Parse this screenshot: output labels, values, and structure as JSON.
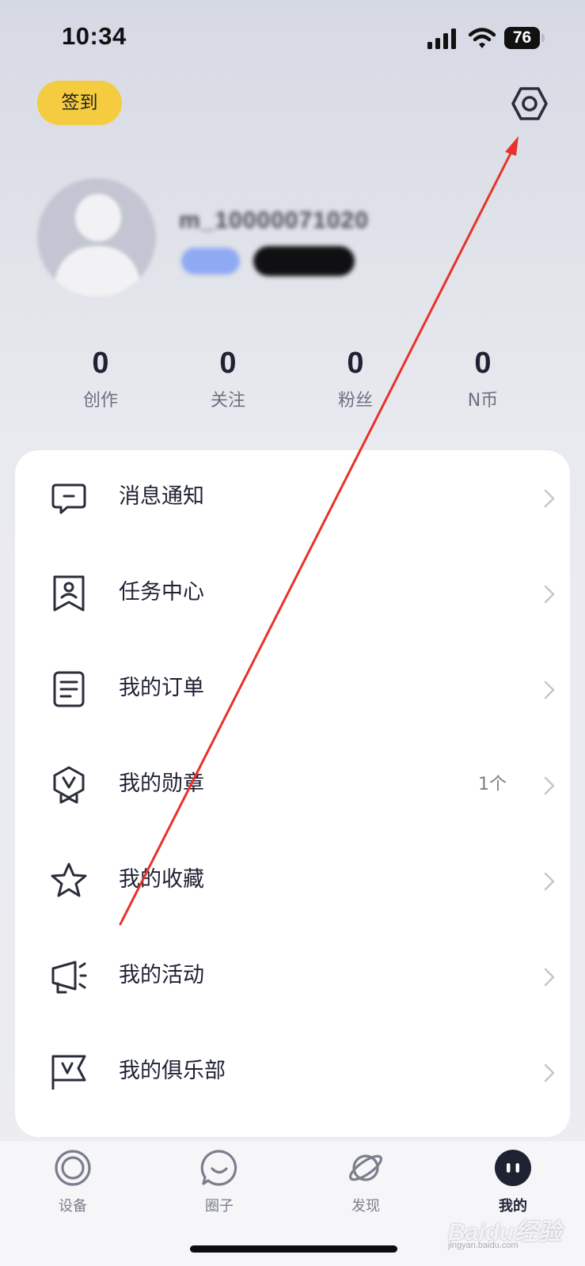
{
  "status_bar": {
    "time": "10:34",
    "battery": "76",
    "icons": [
      "signal-icon",
      "wifi-icon",
      "battery-icon"
    ]
  },
  "header": {
    "checkin_label": "签到",
    "settings_icon": "settings-hexagon-icon"
  },
  "profile": {
    "username": "m_10000071020"
  },
  "stats": [
    {
      "value": "0",
      "label": "创作"
    },
    {
      "value": "0",
      "label": "关注"
    },
    {
      "value": "0",
      "label": "粉丝"
    },
    {
      "value": "0",
      "label": "N币"
    }
  ],
  "menu": {
    "items": [
      {
        "label": "消息通知",
        "icon": "message-icon",
        "extra": ""
      },
      {
        "label": "任务中心",
        "icon": "task-badge-icon",
        "extra": ""
      },
      {
        "label": "我的订单",
        "icon": "order-document-icon",
        "extra": ""
      },
      {
        "label": "我的勋章",
        "icon": "medal-icon",
        "extra": "1个"
      },
      {
        "label": "我的收藏",
        "icon": "star-icon",
        "extra": ""
      },
      {
        "label": "我的活动",
        "icon": "megaphone-icon",
        "extra": ""
      },
      {
        "label": "我的俱乐部",
        "icon": "club-flag-icon",
        "extra": ""
      }
    ]
  },
  "tab_bar": {
    "tabs": [
      {
        "label": "设备",
        "icon": "device-ring-icon",
        "active": false
      },
      {
        "label": "圈子",
        "icon": "circle-chat-icon",
        "active": false
      },
      {
        "label": "发现",
        "icon": "planet-icon",
        "active": false
      },
      {
        "label": "我的",
        "icon": "profile-face-icon",
        "active": true
      }
    ]
  },
  "watermark": {
    "brand": "Baidu经验",
    "sub": "jingyan.baidu.com"
  },
  "colors": {
    "accent_yellow": "#f5cc3f",
    "text_dark": "#1f2233",
    "annotation_red": "#e8322a"
  }
}
